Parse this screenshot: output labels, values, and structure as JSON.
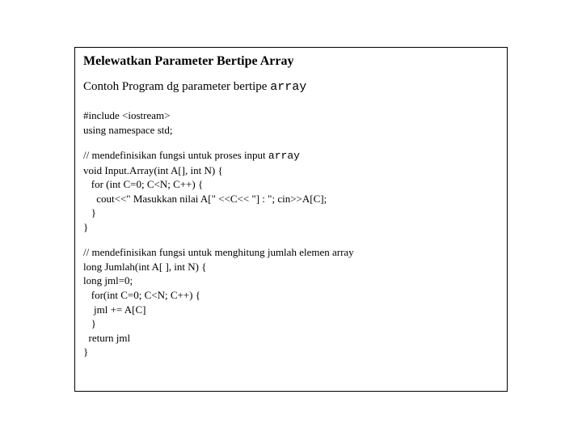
{
  "title": "Melewatkan Parameter Bertipe Array",
  "subtitle_prefix": "Contoh Program dg  parameter bertipe ",
  "subtitle_mono": "array",
  "block1": {
    "l1": "#include <iostream>",
    "l2": "using namespace std;"
  },
  "block2": {
    "l1_prefix": "// mendefinisikan fungsi untuk proses input ",
    "l1_mono": "array",
    "l2": "void Input.Array(int A[], int N) {",
    "l3": "   for (int C=0; C<N; C++) {",
    "l4": "     cout<<\" Masukkan nilai A[\" <<C<< \"] : \"; cin>>A[C];",
    "l5": "   }",
    "l6": "}"
  },
  "block3": {
    "l1": "// mendefinisikan fungsi untuk menghitung jumlah elemen array",
    "l2": "long Jumlah(int A[ ], int N) {",
    "l3": "long jml=0;",
    "l4": "   for(int C=0; C<N; C++) {",
    "l5": "    jml += A[C]",
    "l6": "   }",
    "l7": "  return jml",
    "l8": "}"
  }
}
